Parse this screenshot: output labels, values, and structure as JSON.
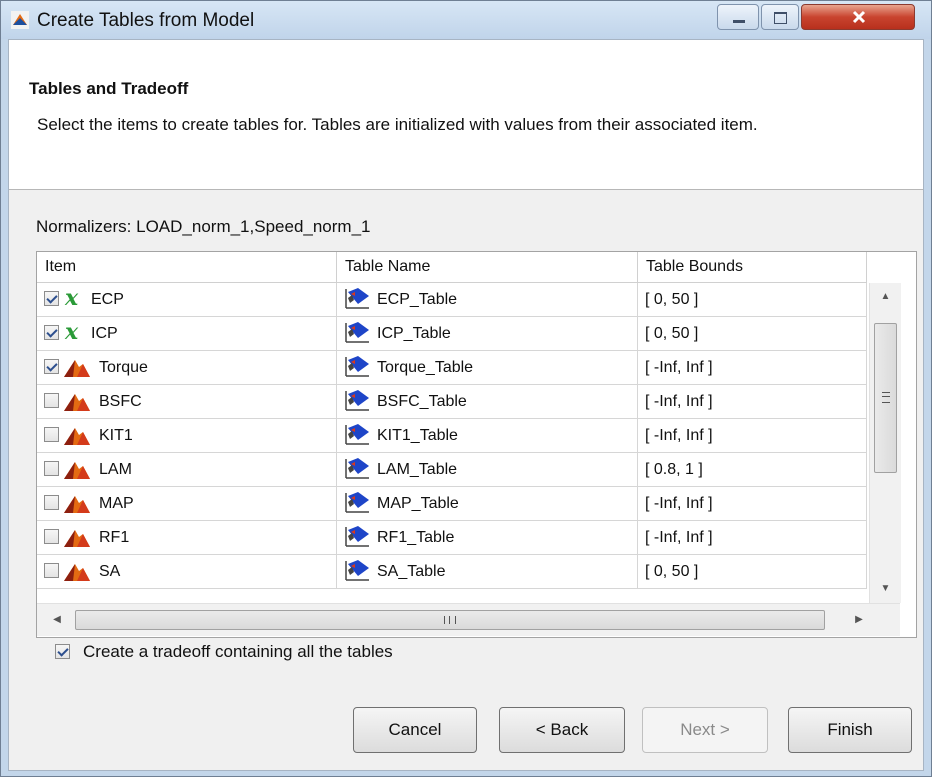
{
  "window": {
    "title": "Create Tables from Model"
  },
  "header": {
    "title": "Tables and Tradeoff",
    "description": "Select the items to create tables for. Tables are initialized with values from their associated item."
  },
  "normalizers": "Normalizers: LOAD_norm_1,Speed_norm_1",
  "table": {
    "columns": [
      "Item",
      "Table Name",
      "Table Bounds"
    ],
    "rows": [
      {
        "checked": true,
        "icon": "variable-x-icon",
        "item": "ECP",
        "table_name": "ECP_Table",
        "bounds": "[ 0, 50 ]"
      },
      {
        "checked": true,
        "icon": "variable-x-icon",
        "item": "ICP",
        "table_name": "ICP_Table",
        "bounds": "[ 0, 50 ]"
      },
      {
        "checked": true,
        "icon": "matlab-peaks-icon",
        "item": "Torque",
        "table_name": "Torque_Table",
        "bounds": "[ -Inf, Inf ]"
      },
      {
        "checked": false,
        "icon": "matlab-peaks-icon",
        "item": "BSFC",
        "table_name": "BSFC_Table",
        "bounds": "[ -Inf, Inf ]"
      },
      {
        "checked": false,
        "icon": "matlab-peaks-icon",
        "item": "KIT1",
        "table_name": "KIT1_Table",
        "bounds": "[ -Inf, Inf ]"
      },
      {
        "checked": false,
        "icon": "matlab-peaks-icon",
        "item": "LAM",
        "table_name": "LAM_Table",
        "bounds": "[ 0.8, 1 ]"
      },
      {
        "checked": false,
        "icon": "matlab-peaks-icon",
        "item": "MAP",
        "table_name": "MAP_Table",
        "bounds": "[ -Inf, Inf ]"
      },
      {
        "checked": false,
        "icon": "matlab-peaks-icon",
        "item": "RF1",
        "table_name": "RF1_Table",
        "bounds": "[ -Inf, Inf ]"
      },
      {
        "checked": false,
        "icon": "matlab-peaks-icon",
        "item": "SA",
        "table_name": "SA_Table",
        "bounds": "[ 0, 50 ]"
      }
    ]
  },
  "tradeoff": {
    "checked": true,
    "label": "Create a tradeoff containing all the tables"
  },
  "buttons": {
    "cancel": "Cancel",
    "back": "< Back",
    "next": "Next >",
    "finish": "Finish"
  },
  "colors": {
    "accent": "#2d4f8e",
    "variable_icon": "#2a9a37",
    "matlab_orange": "#e46a12",
    "window_frame": "#c3d6ea"
  }
}
